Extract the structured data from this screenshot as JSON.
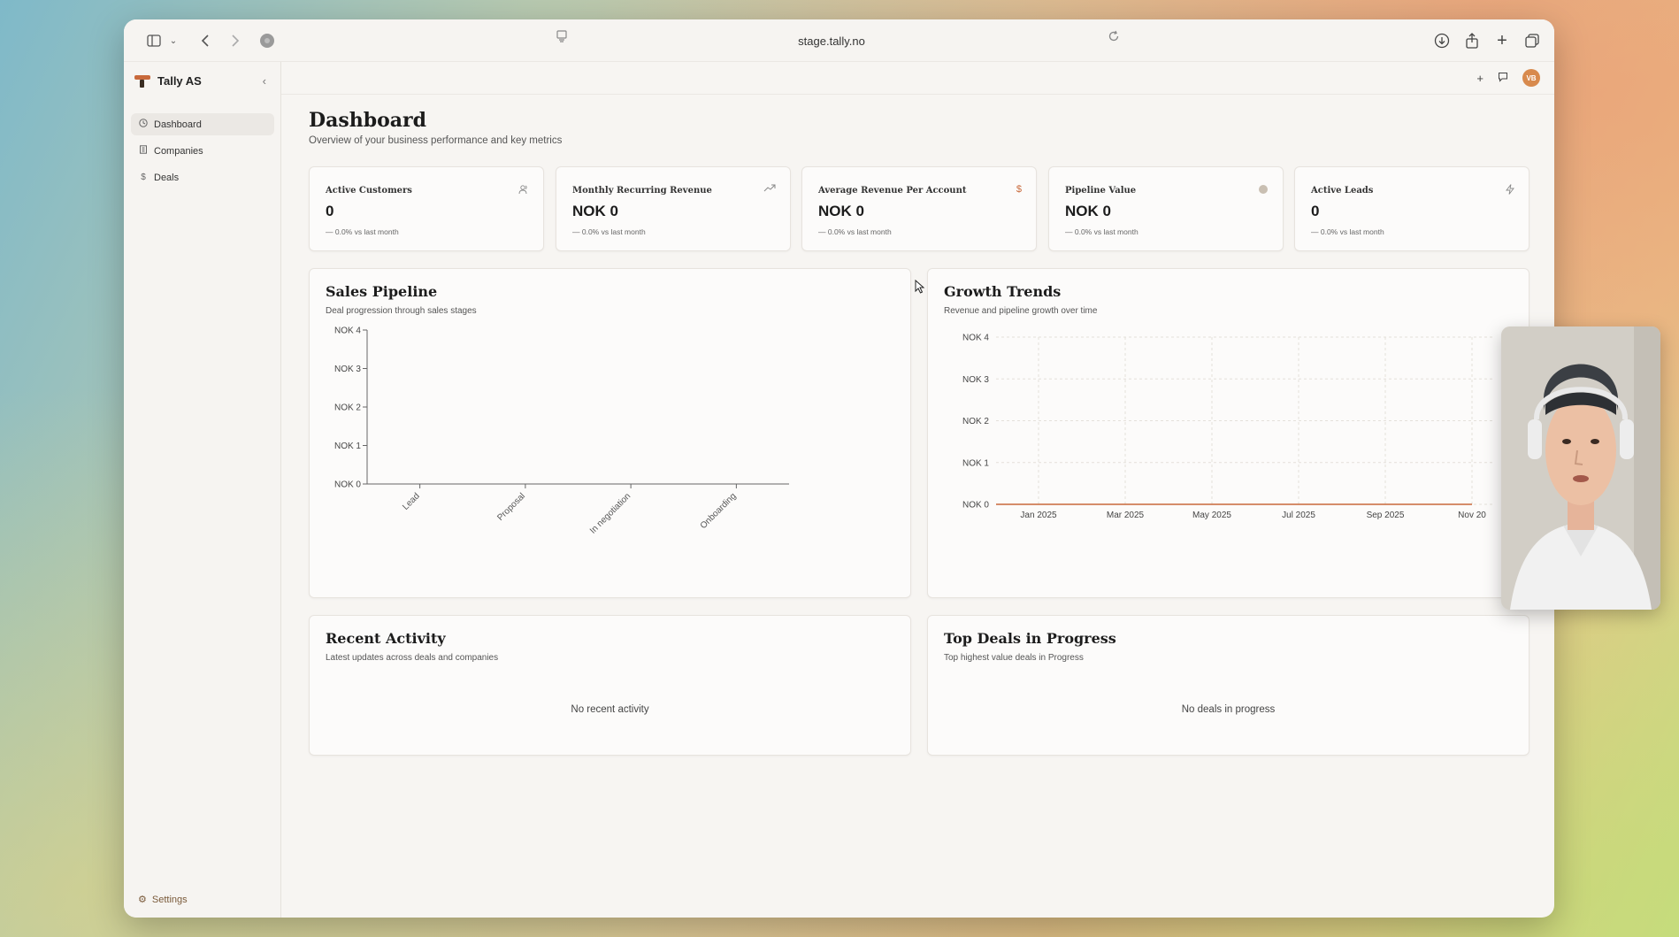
{
  "browser": {
    "url": "stage.tally.no"
  },
  "sidebar": {
    "brand": "Tally AS",
    "items": [
      {
        "label": "Dashboard",
        "icon": "clock-icon",
        "active": true
      },
      {
        "label": "Companies",
        "icon": "building-icon",
        "active": false
      },
      {
        "label": "Deals",
        "icon": "dollar-icon",
        "active": false
      }
    ],
    "settings_label": "Settings"
  },
  "topbar": {
    "avatar_initials": "VB",
    "accent": "#d88a4d"
  },
  "page": {
    "title": "Dashboard",
    "subtitle": "Overview of your business performance and key metrics"
  },
  "kpis": [
    {
      "label": "Active Customers",
      "value": "0",
      "change": "— 0.0% vs last month",
      "icon": "users-icon"
    },
    {
      "label": "Monthly Recurring Revenue",
      "value": "NOK 0",
      "change": "— 0.0% vs last month",
      "icon": "trending-up-icon"
    },
    {
      "label": "Average Revenue Per Account",
      "value": "NOK 0",
      "change": "— 0.0% vs last month",
      "icon": "dollar-icon"
    },
    {
      "label": "Pipeline Value",
      "value": "NOK 0",
      "change": "— 0.0% vs last month",
      "icon": "circle-icon"
    },
    {
      "label": "Active Leads",
      "value": "0",
      "change": "— 0.0% vs last month",
      "icon": "zap-icon"
    }
  ],
  "sales_pipeline": {
    "title": "Sales Pipeline",
    "subtitle": "Deal progression through sales stages"
  },
  "growth_trends": {
    "title": "Growth Trends",
    "subtitle": "Revenue and pipeline growth over time"
  },
  "recent_activity": {
    "title": "Recent Activity",
    "subtitle": "Latest updates across deals and companies",
    "empty": "No recent activity"
  },
  "top_deals": {
    "title": "Top Deals in Progress",
    "subtitle": "Top highest value deals in Progress",
    "empty": "No deals in progress"
  },
  "chart_data": [
    {
      "type": "bar",
      "categories": [
        "Lead",
        "Proposal",
        "In negotiation",
        "Onboarding"
      ],
      "values": [
        0,
        0,
        0,
        0
      ],
      "yticks": [
        "NOK 0",
        "NOK 1",
        "NOK 2",
        "NOK 3",
        "NOK 4"
      ],
      "ylim": [
        0,
        4
      ],
      "grid": false
    },
    {
      "type": "line",
      "x": [
        "Jan 2025",
        "Mar 2025",
        "May 2025",
        "Jul 2025",
        "Sep 2025",
        "Nov 20"
      ],
      "values": [
        0,
        0,
        0,
        0,
        0,
        0
      ],
      "yticks": [
        "NOK 0",
        "NOK 1",
        "NOK 2",
        "NOK 3",
        "NOK 4"
      ],
      "ylim": [
        0,
        4
      ],
      "grid": true,
      "line_color": "#c8693b"
    }
  ]
}
